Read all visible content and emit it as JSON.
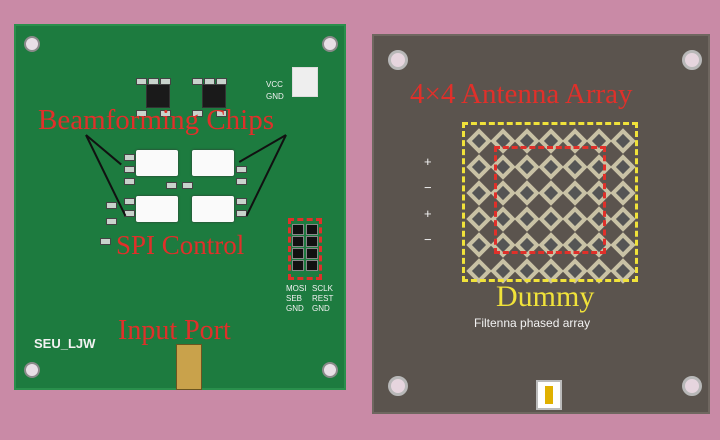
{
  "left_board": {
    "title_chips": "Beamforming Chips",
    "title_spi": "SPI Control",
    "title_input": "Input Port",
    "silk_name": "SEU_LJW",
    "vcc": "VCC",
    "gnd": "GND",
    "pin_labels": [
      "MOSI",
      "SCLK",
      "SEB",
      "REST",
      "GND",
      "GND"
    ]
  },
  "right_board": {
    "title_array": "4×4 Antenna Array",
    "title_dummy": "Dummy",
    "subtitle": "Filtenna phased array",
    "signs": [
      "+",
      "−",
      "+",
      "−"
    ]
  },
  "colors": {
    "background": "#c98aa6",
    "pcb_green": "#1d7b3f",
    "pcb_dark": "#5b544e",
    "annotation_red": "#e0302a",
    "annotation_yellow": "#f0e23a"
  }
}
